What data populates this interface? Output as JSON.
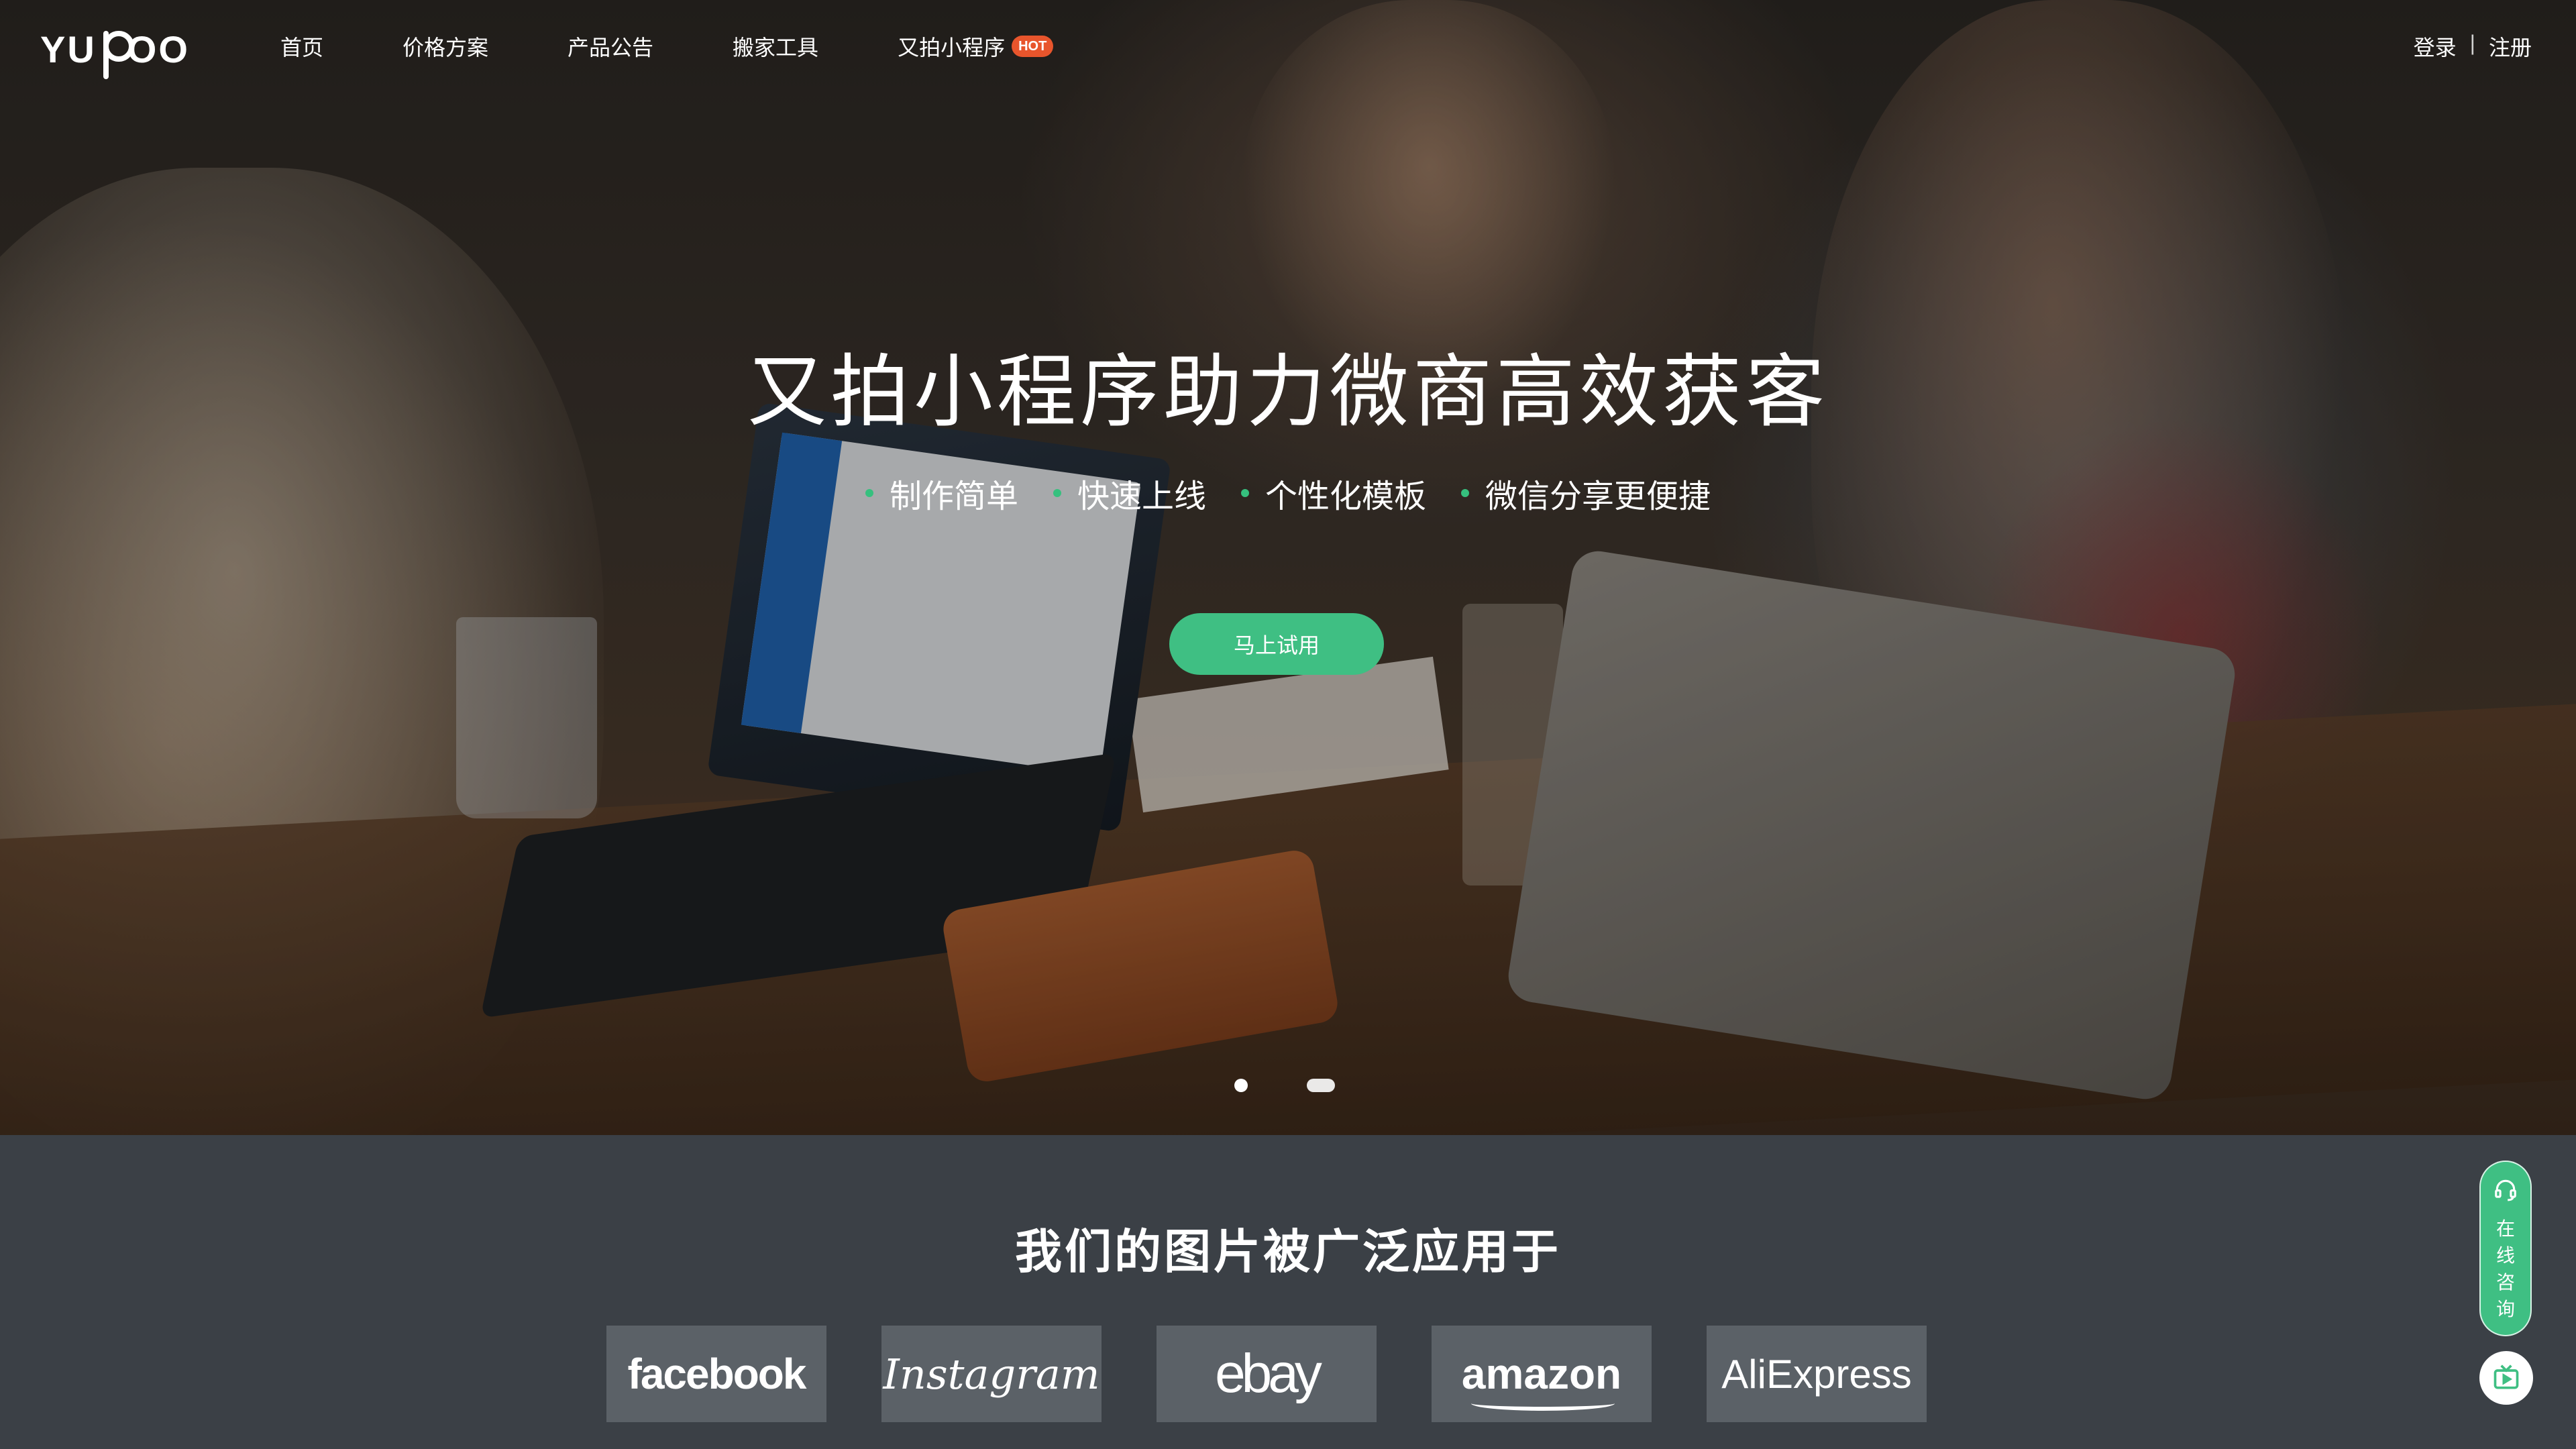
{
  "nav": {
    "logo_text": "YUPOO",
    "menu": [
      {
        "label": "首页"
      },
      {
        "label": "价格方案"
      },
      {
        "label": "产品公告"
      },
      {
        "label": "搬家工具"
      },
      {
        "label": "又拍小程序",
        "badge": "HOT"
      }
    ],
    "auth": {
      "login": "登录",
      "separator": "|",
      "register": "注册"
    }
  },
  "hero": {
    "headline": "又拍小程序助力微商高效获客",
    "features": [
      "制作简单",
      "快速上线",
      "个性化模板",
      "微信分享更便捷"
    ],
    "cta": "马上试用",
    "carousel": {
      "count": 2,
      "active_index": 0
    }
  },
  "brands": {
    "title": "我们的图片被广泛应用于",
    "logos": [
      "facebook",
      "Instagram",
      "ebay",
      "amazon",
      "AliExpress"
    ]
  },
  "floating": {
    "consult_label": "在线咨询",
    "consult_icon": "headset-icon",
    "video_icon": "video-icon"
  },
  "colors": {
    "accent": "#3fbf83",
    "hot_badge": "#e8552c",
    "brand_section_bg": "#3b4046",
    "logo_card_bg": "#5b6167"
  }
}
